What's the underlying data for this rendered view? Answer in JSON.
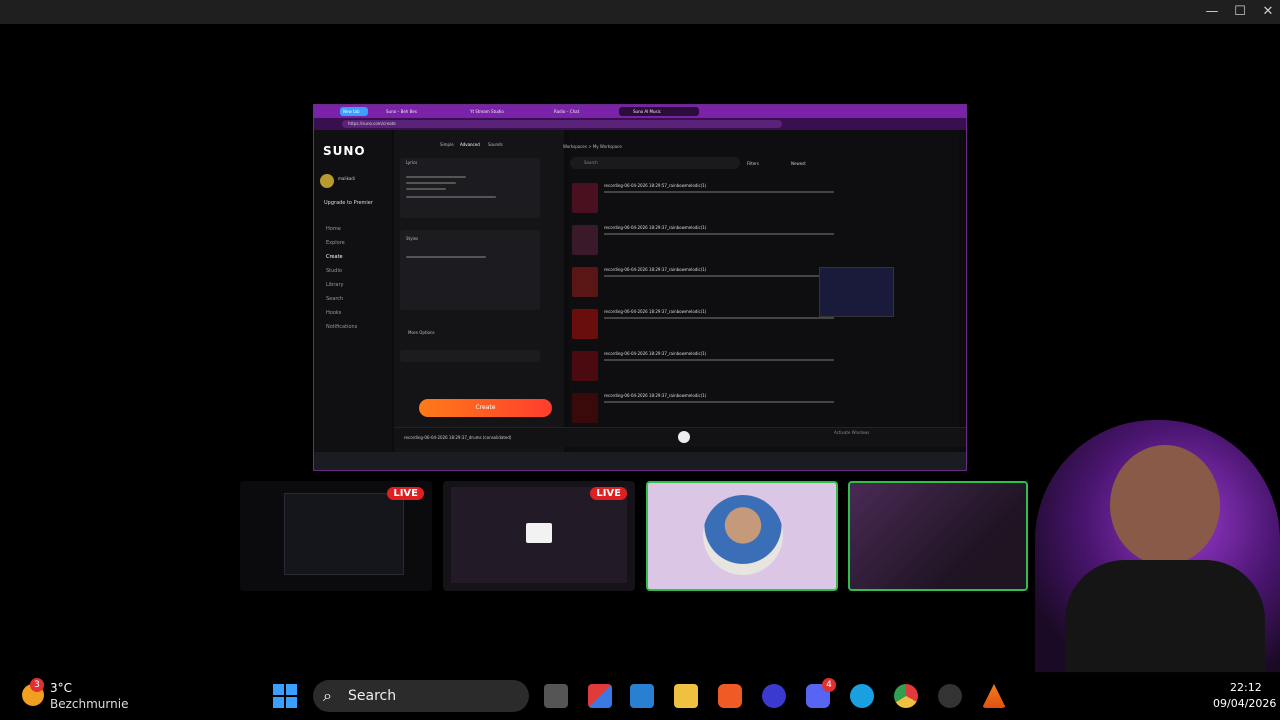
{
  "window": {
    "minimize": "—",
    "maximize": "☐",
    "close": "✕"
  },
  "shared_screen": {
    "tabs": [
      "New tab",
      "Suno – Beh Bes",
      "Yt Stream Studio",
      "Radio – Chat",
      "Suno AI Music"
    ],
    "url": "https://suno.com/create",
    "logo": "SUNO",
    "user_name": "malikadi",
    "upgrade_label": "Upgrade to Premier",
    "sidebar": [
      "Home",
      "Explore",
      "Create",
      "Studio",
      "Library",
      "Search",
      "Hooks",
      "Notifications"
    ],
    "mode_tabs": [
      "Simple",
      "Advanced",
      "Sounds"
    ],
    "lyrics_label": "Lyrics",
    "styles_label": "Styles",
    "more_options": "More Options",
    "create_label": "Create",
    "breadcrumb": "Workspaces  >  My Workspace",
    "search_placeholder": "Search",
    "filters_label": "Filters",
    "newest_label": "Newest",
    "songs": [
      "recording-06-04-2026 18:29:57_rainbowmelodic(1)",
      "recording-06-04-2026 18:29:37_rainbowmelodic(1)",
      "recording-06-04-2026 18:29:37_rainbowmelodic(1)",
      "recording-06-04-2026 18:29:37_rainbowmelodic(1)",
      "recording-06-04-2026 18:29:37_rainbowmelodic(1)",
      "recording-06-04-2026 18:29:37_rainbowmelodic(1)"
    ],
    "now_playing": "recording-06-04-2026 18:29:37_drums (consolidated)",
    "activate": "Activate Windows"
  },
  "tiles": {
    "live_label": "LIVE"
  },
  "taskbar": {
    "weather_badge": "3",
    "temperature": "3°C",
    "location": "Bezchmurnie",
    "search_label": "Search",
    "discord_badge": "4",
    "time": "22:12",
    "date": "09/04/2026"
  },
  "colors": {
    "accent_purple": "#7a22a8",
    "live_red": "#e02020",
    "tile_border_green": "#2fbf4a",
    "create_orange": "#ff5a24"
  }
}
